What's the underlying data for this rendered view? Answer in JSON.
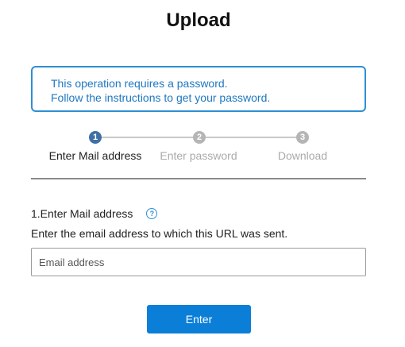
{
  "page": {
    "title": "Upload"
  },
  "notice": {
    "line1": "This operation requires a password.",
    "line2": "Follow the instructions to get your password."
  },
  "stepper": {
    "current_step": 1,
    "steps": [
      {
        "number": "1",
        "label": "Enter Mail address",
        "state": "active"
      },
      {
        "number": "2",
        "label": "Enter password",
        "state": "inactive"
      },
      {
        "number": "3",
        "label": "Download",
        "state": "inactive"
      }
    ]
  },
  "form": {
    "heading": "1.Enter Mail address",
    "help_icon": "question-circle-icon",
    "instruction": "Enter the email address to which this URL was sent.",
    "email_placeholder": "Email address",
    "email_value": "",
    "submit_label": "Enter"
  },
  "colors": {
    "accent": "#2d8fd5",
    "button": "#0b7fd8",
    "active_step": "#3f6fa5",
    "inactive_step": "#b5b5b5"
  }
}
